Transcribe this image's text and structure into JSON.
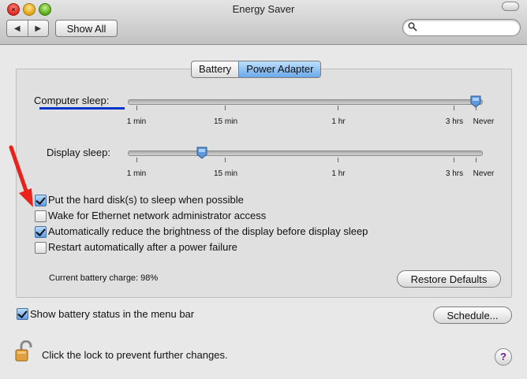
{
  "window": {
    "title": "Energy Saver"
  },
  "toolbar": {
    "back_glyph": "◀",
    "forward_glyph": "▶",
    "show_all_label": "Show All",
    "search_value": ""
  },
  "tabs": [
    {
      "label": "Battery",
      "selected": false
    },
    {
      "label": "Power Adapter",
      "selected": true
    }
  ],
  "computer_sleep": {
    "label": "Computer sleep:",
    "ticks": [
      "1 min",
      "15 min",
      "1 hr",
      "3 hrs",
      "Never"
    ],
    "value": "Never"
  },
  "display_sleep": {
    "label": "Display sleep:",
    "ticks": [
      "1 min",
      "15 min",
      "1 hr",
      "3 hrs",
      "Never"
    ],
    "value": "15 min"
  },
  "options": [
    {
      "label": "Put the hard disk(s) to sleep when possible",
      "checked": true
    },
    {
      "label": "Wake for Ethernet network administrator access",
      "checked": false
    },
    {
      "label": "Automatically reduce the brightness of the display before display sleep",
      "checked": true
    },
    {
      "label": "Restart automatically after a power failure",
      "checked": false
    }
  ],
  "battery_charge_text": "Current battery charge: 98%",
  "restore_defaults_label": "Restore Defaults",
  "show_battery_status": {
    "label": "Show battery status in the menu bar",
    "checked": true
  },
  "schedule_label": "Schedule...",
  "lock_text": "Click the lock to prevent further changes.",
  "help_glyph": "?",
  "colors": {
    "selection_blue": "#6aa9ea",
    "annotation_arrow": "#e8231e",
    "annotation_underline": "#0033cc"
  },
  "icons": [
    "back-arrow-icon",
    "forward-arrow-icon",
    "search-icon",
    "slider-thumb-icon",
    "lock-icon",
    "help-icon",
    "red-annotation-arrow-icon"
  ]
}
